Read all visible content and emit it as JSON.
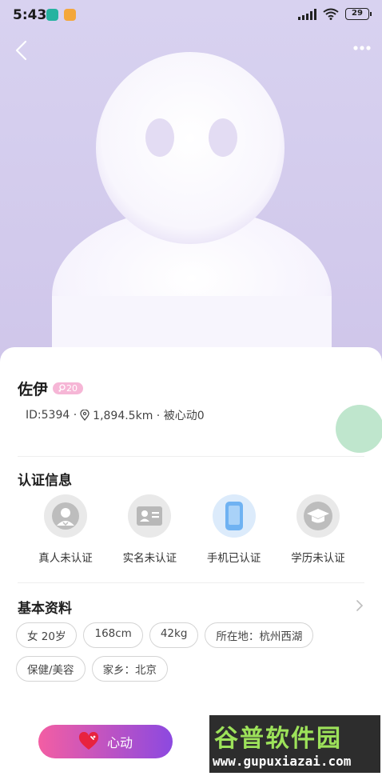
{
  "status_bar": {
    "time": "5:43",
    "battery": "29"
  },
  "profile": {
    "name": "佐伊",
    "age_badge": "20",
    "id_text": "ID:5394 ·",
    "distance_text": "1,894.5km · 被心动0"
  },
  "verification": {
    "title": "认证信息",
    "items": [
      {
        "label": "真人未认证",
        "icon": "person-icon",
        "verified": false
      },
      {
        "label": "实名未认证",
        "icon": "id-card-icon",
        "verified": false
      },
      {
        "label": "手机已认证",
        "icon": "phone-icon",
        "verified": true
      },
      {
        "label": "学历未认证",
        "icon": "graduation-cap-icon",
        "verified": false
      }
    ]
  },
  "basic_info": {
    "title": "基本资料",
    "tags": [
      "女 20岁",
      "168cm",
      "42kg",
      "所在地：杭州西湖",
      "保健/美容",
      "家乡：北京"
    ]
  },
  "actions": {
    "like_label": "心动"
  },
  "watermark": {
    "top": "谷普软件园",
    "bottom": "www.gupuxiazai.com"
  },
  "colors": {
    "hero_bg": "#d8d2f0",
    "accent_gradient_start": "#f35ea3",
    "accent_gradient_end": "#8c49e0",
    "verified_blue": "#5aa5ee"
  }
}
